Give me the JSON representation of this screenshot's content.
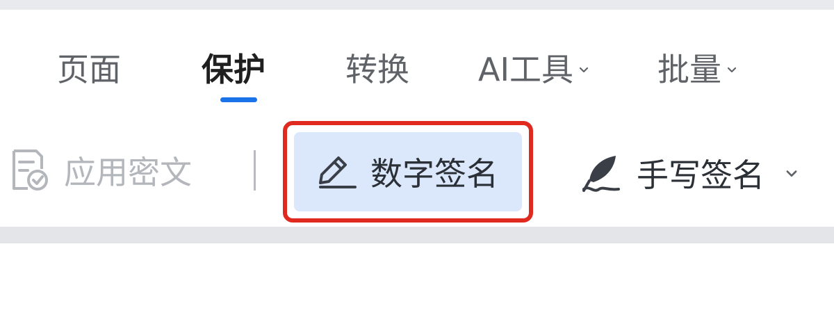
{
  "tabs": [
    {
      "label": "页面",
      "active": false,
      "has_dropdown": false
    },
    {
      "label": "保护",
      "active": true,
      "has_dropdown": false
    },
    {
      "label": "转换",
      "active": false,
      "has_dropdown": false
    },
    {
      "label": "AI工具",
      "active": false,
      "has_dropdown": true
    },
    {
      "label": "批量",
      "active": false,
      "has_dropdown": true
    }
  ],
  "toolbar": {
    "apply_redaction": {
      "label": "应用密文",
      "icon": "document-check-icon",
      "enabled": false
    },
    "digital_signature": {
      "label": "数字签名",
      "icon": "pen-icon",
      "highlighted": true
    },
    "handwritten_signature": {
      "label": "手写签名",
      "icon": "quill-icon",
      "has_dropdown": true
    }
  },
  "colors": {
    "accent": "#1a73e8",
    "highlight_border": "#e02a20",
    "button_fill": "#dbe7fb"
  }
}
